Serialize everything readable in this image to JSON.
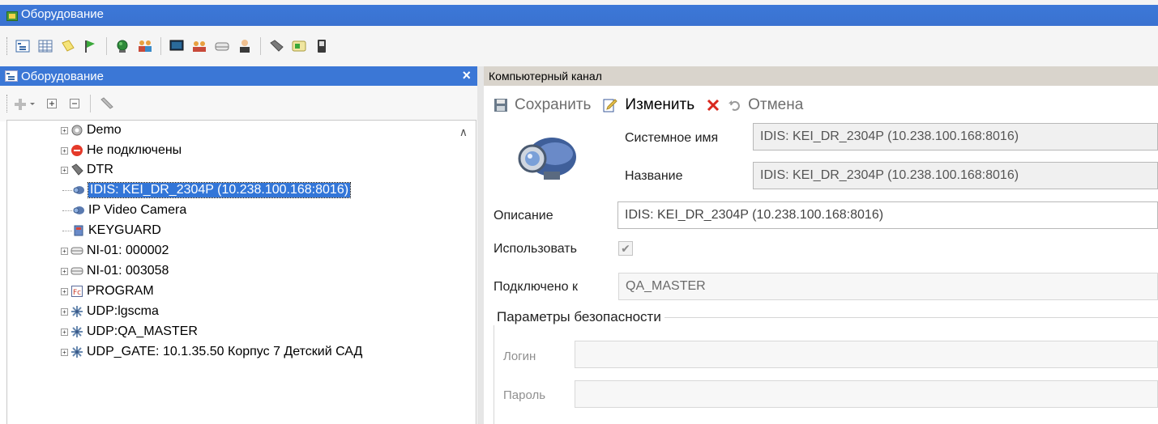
{
  "window": {
    "title": "Оборудование"
  },
  "toolbar": {
    "icons": [
      "tree-view-icon",
      "grid-icon",
      "notes-icon",
      "flag-icon",
      "globe-icon",
      "users-icon",
      "monitor-icon",
      "group-icon",
      "drive-icon",
      "person-icon",
      "tag-icon",
      "card-icon",
      "phone-icon"
    ]
  },
  "left_pane": {
    "title": "Оборудование",
    "close_glyph": "×",
    "tree": [
      {
        "label": "Demo",
        "icon": "gear-icon",
        "expandable": true,
        "selected": false
      },
      {
        "label": "Не подключены",
        "icon": "stop-icon",
        "expandable": true,
        "selected": false
      },
      {
        "label": "DTR",
        "icon": "tag-icon",
        "expandable": true,
        "selected": false
      },
      {
        "label": "IDIS: KEI_DR_2304P (10.238.100.168:8016)",
        "icon": "camera-icon",
        "expandable": false,
        "selected": true
      },
      {
        "label": "IP Video Camera",
        "icon": "camera-icon",
        "expandable": false,
        "selected": false
      },
      {
        "label": "KEYGUARD",
        "icon": "keyguard-icon",
        "expandable": false,
        "selected": false
      },
      {
        "label": "NI-01: 000002",
        "icon": "drive-icon",
        "expandable": true,
        "selected": false
      },
      {
        "label": "NI-01: 003058",
        "icon": "drive-icon",
        "expandable": true,
        "selected": false
      },
      {
        "label": "PROGRAM",
        "icon": "program-icon",
        "expandable": true,
        "selected": false
      },
      {
        "label": "UDP:lgscma",
        "icon": "network-icon",
        "expandable": true,
        "selected": false
      },
      {
        "label": "UDP:QA_MASTER",
        "icon": "network-icon",
        "expandable": true,
        "selected": false
      },
      {
        "label": "UDP_GATE: 10.1.35.50 Корпус 7 Детский САД",
        "icon": "network-icon",
        "expandable": true,
        "selected": false
      }
    ]
  },
  "right_pane": {
    "title": "Компьютерный канал",
    "actions": {
      "save": "Сохранить",
      "edit": "Изменить",
      "cancel": "Отмена"
    },
    "form": {
      "system_name_label": "Системное имя",
      "system_name_value": "IDIS: KEI_DR_2304P (10.238.100.168:8016)",
      "name_label": "Название",
      "name_value": "IDIS: KEI_DR_2304P (10.238.100.168:8016)",
      "description_label": "Описание",
      "description_value": "IDIS: KEI_DR_2304P (10.238.100.168:8016)",
      "use_label": "Использовать",
      "use_checked": true,
      "connected_label": "Подключено к",
      "connected_value": "QA_MASTER"
    },
    "security": {
      "title": "Параметры безопасности",
      "login_label": "Логин",
      "login_value": "",
      "password_label": "Пароль",
      "password_value": ""
    }
  },
  "colors": {
    "title_bar": "#3a72d0",
    "pane_header": "#3b77d6",
    "selection": "#3376d8",
    "right_header": "#d9d4cc",
    "cancel_red": "#d9281e"
  }
}
